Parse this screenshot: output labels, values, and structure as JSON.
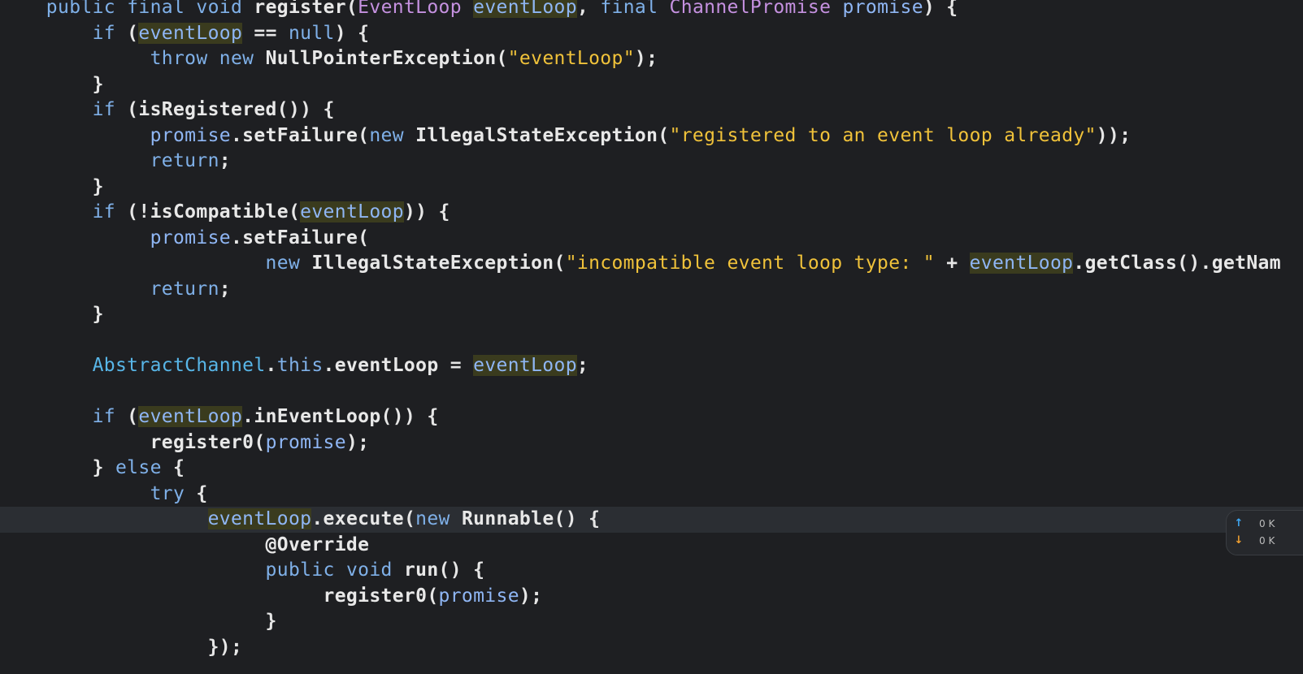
{
  "editor": {
    "language": "java",
    "lines": [
      {
        "indent": "    ",
        "tokens": [
          [
            "kw",
            "public"
          ],
          [
            "punc",
            " "
          ],
          [
            "kw",
            "final"
          ],
          [
            "punc",
            " "
          ],
          [
            "kw",
            "void"
          ],
          [
            "punc",
            " "
          ],
          [
            "method",
            "register"
          ],
          [
            "punc",
            "("
          ],
          [
            "type",
            "EventLoop"
          ],
          [
            "punc",
            " "
          ],
          [
            "hl",
            "eventLoop"
          ],
          [
            "punc",
            ", "
          ],
          [
            "kw",
            "final"
          ],
          [
            "punc",
            " "
          ],
          [
            "type",
            "ChannelPromise"
          ],
          [
            "punc",
            " "
          ],
          [
            "param",
            "promise"
          ],
          [
            "punc",
            ") {"
          ]
        ]
      },
      {
        "indent": "        ",
        "tokens": [
          [
            "kw",
            "if"
          ],
          [
            "punc",
            " ("
          ],
          [
            "hl",
            "eventLoop"
          ],
          [
            "punc",
            " == "
          ],
          [
            "kw",
            "null"
          ],
          [
            "punc",
            ") {"
          ]
        ]
      },
      {
        "indent": "             ",
        "tokens": [
          [
            "kw",
            "throw"
          ],
          [
            "punc",
            " "
          ],
          [
            "kw",
            "new"
          ],
          [
            "punc",
            " "
          ],
          [
            "cls",
            "NullPointerException"
          ],
          [
            "punc",
            "("
          ],
          [
            "str",
            "\"eventLoop\""
          ],
          [
            "punc",
            ");"
          ]
        ]
      },
      {
        "indent": "        ",
        "tokens": [
          [
            "punc",
            "}"
          ]
        ]
      },
      {
        "indent": "        ",
        "tokens": [
          [
            "kw",
            "if"
          ],
          [
            "punc",
            " ("
          ],
          [
            "method",
            "isRegistered"
          ],
          [
            "punc",
            "()) {"
          ]
        ]
      },
      {
        "indent": "             ",
        "tokens": [
          [
            "param",
            "promise"
          ],
          [
            "punc",
            "."
          ],
          [
            "method",
            "setFailure"
          ],
          [
            "punc",
            "("
          ],
          [
            "kw",
            "new"
          ],
          [
            "punc",
            " "
          ],
          [
            "cls",
            "IllegalStateException"
          ],
          [
            "punc",
            "("
          ],
          [
            "str",
            "\"registered to an event loop already\""
          ],
          [
            "punc",
            "));"
          ]
        ]
      },
      {
        "indent": "             ",
        "tokens": [
          [
            "kw",
            "return"
          ],
          [
            "punc",
            ";"
          ]
        ]
      },
      {
        "indent": "        ",
        "tokens": [
          [
            "punc",
            "}"
          ]
        ]
      },
      {
        "indent": "        ",
        "tokens": [
          [
            "kw",
            "if"
          ],
          [
            "punc",
            " (!"
          ],
          [
            "method",
            "isCompatible"
          ],
          [
            "punc",
            "("
          ],
          [
            "hl",
            "eventLoop"
          ],
          [
            "punc",
            ")) {"
          ]
        ]
      },
      {
        "indent": "             ",
        "tokens": [
          [
            "param",
            "promise"
          ],
          [
            "punc",
            "."
          ],
          [
            "method",
            "setFailure"
          ],
          [
            "punc",
            "("
          ]
        ]
      },
      {
        "indent": "                       ",
        "tokens": [
          [
            "kw",
            "new"
          ],
          [
            "punc",
            " "
          ],
          [
            "cls",
            "IllegalStateException"
          ],
          [
            "punc",
            "("
          ],
          [
            "str",
            "\"incompatible event loop type: \""
          ],
          [
            "punc",
            " + "
          ],
          [
            "hl",
            "eventLoop"
          ],
          [
            "punc",
            "."
          ],
          [
            "method",
            "getClass"
          ],
          [
            "punc",
            "()."
          ],
          [
            "method",
            "getNam"
          ]
        ]
      },
      {
        "indent": "             ",
        "tokens": [
          [
            "kw",
            "return"
          ],
          [
            "punc",
            ";"
          ]
        ]
      },
      {
        "indent": "        ",
        "tokens": [
          [
            "punc",
            "}"
          ]
        ]
      },
      {
        "indent": "",
        "tokens": []
      },
      {
        "indent": "        ",
        "tokens": [
          [
            "cls2",
            "AbstractChannel"
          ],
          [
            "punc",
            "."
          ],
          [
            "kw",
            "this"
          ],
          [
            "punc",
            "."
          ],
          [
            "field",
            "eventLoop"
          ],
          [
            "punc",
            " = "
          ],
          [
            "hl",
            "eventLoop"
          ],
          [
            "punc",
            ";"
          ]
        ]
      },
      {
        "indent": "",
        "tokens": []
      },
      {
        "indent": "        ",
        "tokens": [
          [
            "kw",
            "if"
          ],
          [
            "punc",
            " ("
          ],
          [
            "hl",
            "eventLoop"
          ],
          [
            "punc",
            "."
          ],
          [
            "method",
            "inEventLoop"
          ],
          [
            "punc",
            "()) {"
          ]
        ]
      },
      {
        "indent": "             ",
        "tokens": [
          [
            "method",
            "register0"
          ],
          [
            "punc",
            "("
          ],
          [
            "param",
            "promise"
          ],
          [
            "punc",
            ");"
          ]
        ]
      },
      {
        "indent": "        ",
        "tokens": [
          [
            "punc",
            "} "
          ],
          [
            "kw",
            "else"
          ],
          [
            "punc",
            " {"
          ]
        ]
      },
      {
        "indent": "             ",
        "tokens": [
          [
            "kw",
            "try"
          ],
          [
            "punc",
            " {"
          ]
        ]
      },
      {
        "indent": "                  ",
        "current": true,
        "tokens": [
          [
            "hl",
            "eventLoop"
          ],
          [
            "punc",
            "."
          ],
          [
            "method",
            "execute"
          ],
          [
            "punc",
            "("
          ],
          [
            "kw",
            "new"
          ],
          [
            "punc",
            " "
          ],
          [
            "cls",
            "Runnable"
          ],
          [
            "punc",
            "() {"
          ]
        ]
      },
      {
        "indent": "                       ",
        "tokens": [
          [
            "ann",
            "@Override"
          ]
        ]
      },
      {
        "indent": "                       ",
        "tokens": [
          [
            "kw",
            "public"
          ],
          [
            "punc",
            " "
          ],
          [
            "kw",
            "void"
          ],
          [
            "punc",
            " "
          ],
          [
            "method",
            "run"
          ],
          [
            "punc",
            "() {"
          ]
        ]
      },
      {
        "indent": "                            ",
        "tokens": [
          [
            "method",
            "register0"
          ],
          [
            "punc",
            "("
          ],
          [
            "param",
            "promise"
          ],
          [
            "punc",
            ");"
          ]
        ]
      },
      {
        "indent": "                       ",
        "tokens": [
          [
            "punc",
            "}"
          ]
        ]
      },
      {
        "indent": "                  ",
        "tokens": [
          [
            "punc",
            "});"
          ]
        ]
      }
    ]
  },
  "vcs_widget": {
    "up_icon": "arrow-up-icon",
    "up_arrow": "↑",
    "up_value": "0 K",
    "down_icon": "arrow-down-icon",
    "down_arrow": "↓",
    "down_value": "0 K"
  }
}
